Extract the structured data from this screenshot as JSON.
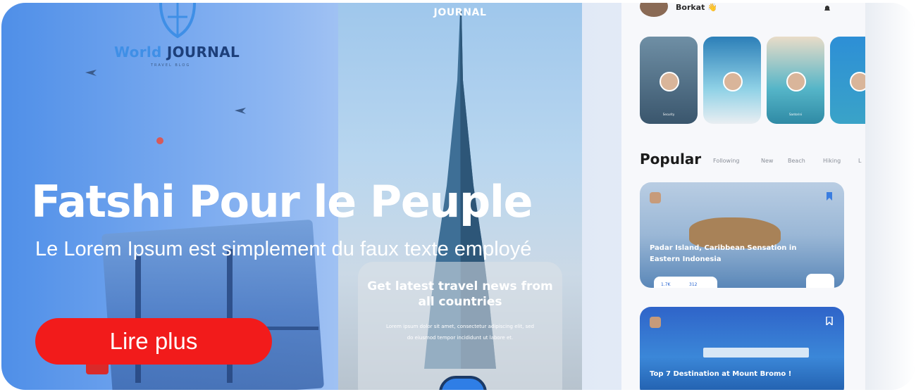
{
  "banner": {
    "headline": "Fatshi Pour le Peuple",
    "subtitle": "Le Lorem Ipsum est simplement du faux texte employé",
    "cta_label": "Lire plus",
    "cta_color": "#f21b1b"
  },
  "left_mockup": {
    "logo_word1": "World",
    "logo_word2": " JOURNAL",
    "logo_tagline": "TRAVEL BLOG"
  },
  "phone_mockup": {
    "title": "JOURNAL",
    "heading": "Get latest travel news from all countries",
    "body": "Lorem ipsum dolor sit amet, consectetur adipiscing elit, sed do eiusmod tempor incididunt ut labore et."
  },
  "app_mockup": {
    "user_name": "Borkat",
    "user_emoji": "👋",
    "stories": [
      "Security",
      "",
      "Santorini",
      ""
    ],
    "section_title": "Popular",
    "tabs": [
      "Following",
      "New",
      "Beach",
      "Hiking",
      "L"
    ],
    "posts": [
      {
        "title": "Padar Island, Caribbean Sensation in Eastern Indonesia",
        "likes": "1.7K",
        "comments": "312"
      },
      {
        "title": "Top 7 Destination at Mount Bromo !"
      }
    ]
  }
}
